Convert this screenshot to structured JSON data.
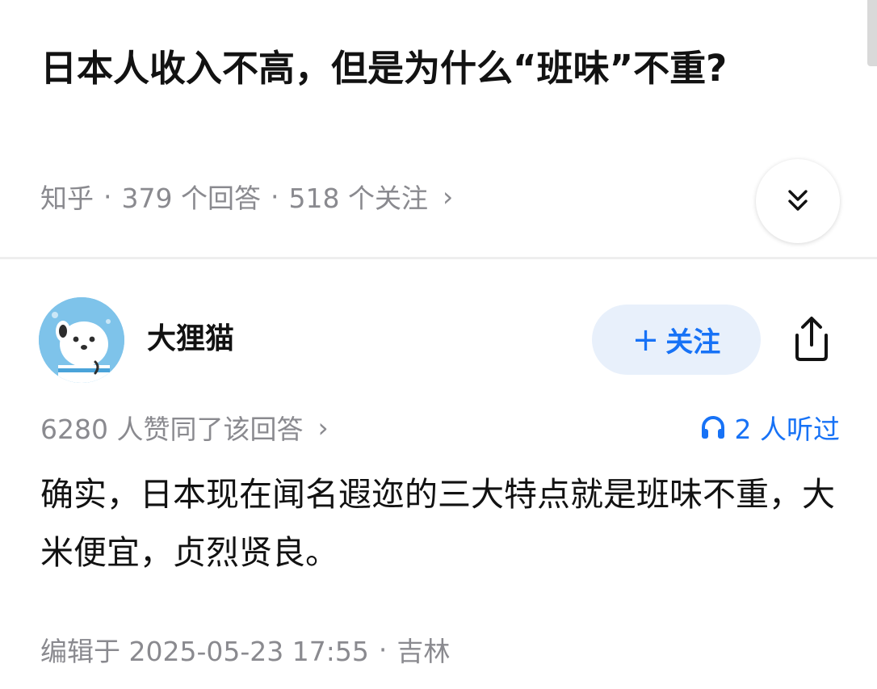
{
  "question": {
    "title": "日本人收入不高，但是为什么“班味”不重?",
    "source": "知乎",
    "separator": "·",
    "answer_count": "379 个回答",
    "follower_count": "518 个关注",
    "chevron": "›"
  },
  "icons": {
    "collapse": "double-chevron-down-icon",
    "share": "share-icon",
    "headphones": "headphones-icon",
    "avatar": "cartoon-dog-avatar"
  },
  "answer": {
    "author_name": "大狸猫",
    "follow_label": "关注",
    "follow_plus": "+",
    "vote_text": "6280 人赞同了该回答",
    "listened_text": "2 人听过",
    "content": "确实，日本现在闻名遐迩的三大特点就是班味不重，大米便宜，贞烈贤良。",
    "edited_text": "编辑于 2025-05-23 17:55",
    "location": "吉林"
  },
  "colors": {
    "accent": "#1772f6",
    "follow_bg": "#e8f0fb",
    "meta_text": "#8a8a8f",
    "title_text": "#121212",
    "avatar_bg": "#7ec3ea"
  }
}
